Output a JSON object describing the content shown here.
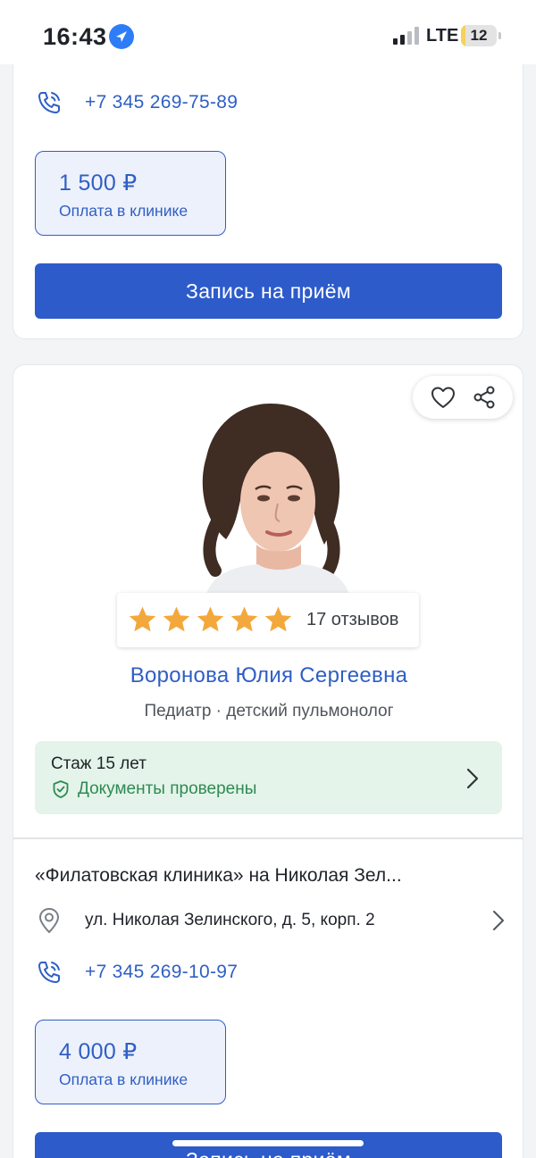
{
  "status_bar": {
    "time": "16:43",
    "network": "LTE",
    "battery": "12",
    "battery_level": 0.12
  },
  "top_card": {
    "phone": "+7 345 269-75-89",
    "price": "1 500 ₽",
    "price_note": "Оплата в клинике",
    "book_label": "Запись на приём"
  },
  "doctor_card": {
    "rating": {
      "stars": 5,
      "reviews": "17 отзывов"
    },
    "name": "Воронова Юлия Сергеевна",
    "specialty": "Педиатр · детский пульмонолог",
    "experience": "Стаж 15 лет",
    "verified": "Документы проверены",
    "clinic": {
      "name": "«Филатовская клиника» на Николая Зел...",
      "address": "ул. Николая Зелинского, д. 5, корп. 2",
      "phone": "+7 345 269-10-97",
      "price": "4 000 ₽",
      "price_note": "Оплата в клинике",
      "book_label": "Запись на приём"
    }
  },
  "colors": {
    "accent": "#2d5bca",
    "link": "#2f5fc4",
    "star": "#f3a83b",
    "verified": "#2f8a53"
  },
  "icons": [
    "location-arrow-icon",
    "signal-icon",
    "phone-icon",
    "heart-icon",
    "share-icon",
    "star-icon",
    "shield-check-icon",
    "chevron-right-icon",
    "map-pin-icon"
  ]
}
